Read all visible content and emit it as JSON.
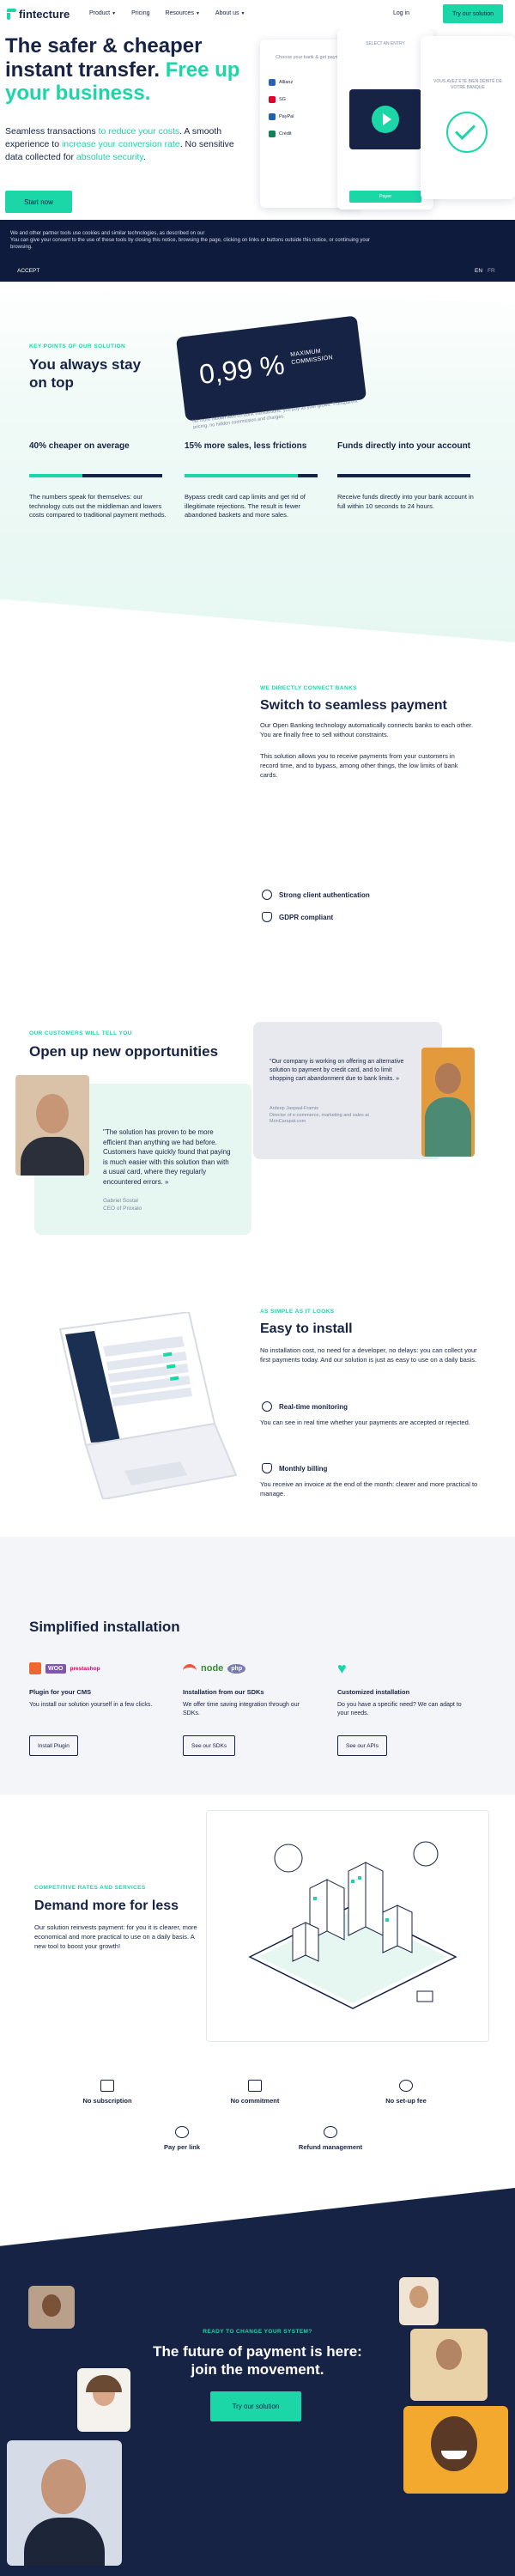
{
  "nav": {
    "logo": "fintecture",
    "menu": [
      {
        "label": "Product"
      },
      {
        "label": "Pricing"
      },
      {
        "label": "Resources"
      },
      {
        "label": "About us"
      }
    ],
    "login": "Log in",
    "cta": "Try our solution"
  },
  "hero": {
    "title_part1": "The safer & cheaper instant transfer. ",
    "title_accent": "Free up your business.",
    "sub_1": "Seamless transactions ",
    "sub_hl1": "to reduce your costs",
    "sub_2": ". A smooth experience to ",
    "sub_hl2": "increase your conversion rate",
    "sub_3": ". No sensitive data collected for ",
    "sub_hl3": "absolute security",
    "sub_4": ".",
    "button": "Start now",
    "mock_bank_label": "Choose your bank & get payment",
    "mock_select": "SELECT AN ENTRY",
    "mock_done": "VOUS AVEZ ÉTÉ BIEN DÉBITÉ DE VOTRE BANQUE",
    "mock_banks": [
      "Allianz",
      "SG",
      "PayPal",
      "Crédit"
    ],
    "mock_pay": "Payer"
  },
  "cookie": {
    "text": "We and other partner tools use cookies and similar technologies, as described on our\nYou can give your consent to the use of these tools by closing this notice, browsing the page, clicking on links or buttons outside this notice, or continuing your browsing.",
    "accept": "ACCEPT",
    "lang_en": "EN",
    "lang_fr": "FR"
  },
  "stay": {
    "eyebrow": "KEY POINTS OF OUR SOLUTION",
    "title": "You always stay on top",
    "commission_value": "0,99 %",
    "commission_label_1": "MAXIMUM",
    "commission_label_2": "COMMISSION",
    "commission_note": "No more hidden fees on bank transactions: you pay as your grows. Transparent pricing, no hidden commission and charges.",
    "stats": [
      {
        "title": "40% cheaper on average",
        "fill": 0.4,
        "text": "The numbers speak for themselves: our technology cuts out the middleman and lowers costs compared to traditional payment methods."
      },
      {
        "title": "15% more sales, less frictions",
        "fill": 0.85,
        "text": "Bypass credit card cap limits and get rid of illegitimate rejections. The result is fewer abandoned baskets and more sales."
      },
      {
        "title": "Funds directly into your account",
        "fill": 0.0,
        "text": "Receive funds directly into your bank account in full within 10 seconds to 24 hours."
      }
    ]
  },
  "seamless": {
    "eyebrow": "WE DIRECTLY CONNECT BANKS",
    "title": "Switch to seamless payment",
    "p1": "Our Open Banking technology automatically connects banks to each other. You are finally free to sell without constraints.",
    "p2": "This solution allows you to receive payments from your customers in record time, and to bypass, among other things, the low limits of bank cards.",
    "f1": "Strong client authentication",
    "f2": "GDPR compliant"
  },
  "opportunities": {
    "eyebrow": "OUR CUSTOMERS WILL TELL YOU",
    "title": "Open up new opportunities",
    "quote1": "\"The solution has proven to be more efficient than anything we had before. Customers have quickly found that paying is much easier with this solution than with a usual card, where they regularly encountered errors. »",
    "author1_name": "Gabriel Sostal",
    "author1_role": "CEO of Proxalo",
    "quote2": "\"Our company is working on offering an alternative solution to payment by credit card, and to limit shopping cart abandonment due to bank limits. »",
    "author2_name": "Ardeep Jaspaul-Framis",
    "author2_role": "Director of e-commerce, marketing and sales at MonCarapat.com"
  },
  "easy": {
    "eyebrow": "AS SIMPLE AS IT LOOKS",
    "title": "Easy to install",
    "p1": "No installation cost, no need for a developer, no delays: you can collect your first payments today. And our solution is just as easy to use on a daily basis.",
    "f1": "Real-time monitoring",
    "p2": "You can see in real time whether your payments are accepted or rejected.",
    "f2": "Monthly billing",
    "p3": "You receive an invoice at the end of the month: clearer and more practical to manage."
  },
  "simplified": {
    "title": "Simplified installation",
    "cols": [
      {
        "logos": [
          "Magento",
          "WOO",
          "prestashop"
        ],
        "heading": "Plugin for your CMS",
        "text": "You install our solution yourself in a few clicks.",
        "button": "Install Plugin"
      },
      {
        "logos": [
          "Laravel",
          "node",
          "php"
        ],
        "heading": "Installation from our SDKs",
        "text": "We offer time saving integration through our SDKs.",
        "button": "See our SDKs"
      },
      {
        "logos": [
          "heart"
        ],
        "heading": "Customized installation",
        "text": "Do you have a specific need? We can adapt to your needs.",
        "button": "See our APIs"
      }
    ]
  },
  "demand": {
    "eyebrow": "COMPETITIVE RATES AND SERVICES",
    "title": "Demand more for less",
    "p": "Our solution reinvests payment: for you it is clearer, more economical and more practical to use on a daily basis. A new tool to boost your growth!",
    "benefits": [
      "No subscription",
      "No commitment",
      "No set-up fee",
      "Pay per link",
      "Refund management"
    ]
  },
  "cta": {
    "eyebrow": "READY TO CHANGE YOUR SYSTEM?",
    "title": "The future of payment is here: join the movement.",
    "button": "Try our solution"
  },
  "colors": {
    "brand_green": "#1bd6a7",
    "navy": "#172344",
    "cookie_bg": "#0f1b3d"
  }
}
